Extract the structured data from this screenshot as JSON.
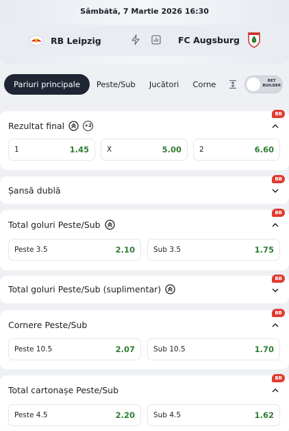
{
  "header": {
    "date": "Sâmbătă, 7 Martie 2026 16:30",
    "home_team": "RB Leipzig",
    "away_team": "FC Augsburg",
    "icons": [
      "rb-leipzig-crest",
      "lightning-icon",
      "stats-icon",
      "fc-augsburg-crest"
    ]
  },
  "tabs": [
    {
      "label": "Pariuri principale",
      "active": true
    },
    {
      "label": "Peste/Sub"
    },
    {
      "label": "Jucători"
    },
    {
      "label": "Corne"
    }
  ],
  "bet_builder": {
    "line1": "BET",
    "line2": "BUILDER"
  },
  "badge": "BB",
  "markets": [
    {
      "title": "Rezultat final",
      "extra": "+2",
      "outcomes": [
        {
          "label": "1",
          "odds": "1.45"
        },
        {
          "label": "X",
          "odds": "5.00"
        },
        {
          "label": "2",
          "odds": "6.60"
        }
      ]
    },
    {
      "title": "Șansă dublă",
      "outcomes": []
    },
    {
      "title": "Total goluri Peste/Sub",
      "outcomes": [
        {
          "label": "Peste 3.5",
          "odds": "2.10"
        },
        {
          "label": "Sub 3.5",
          "odds": "1.75"
        }
      ]
    },
    {
      "title": "Total goluri Peste/Sub (suplimentar)",
      "outcomes": []
    },
    {
      "title": "Cornere Peste/Sub",
      "outcomes": [
        {
          "label": "Peste 10.5",
          "odds": "2.07"
        },
        {
          "label": "Sub 10.5",
          "odds": "1.70"
        }
      ]
    },
    {
      "title": "Total cartonașe Peste/Sub",
      "outcomes": [
        {
          "label": "Peste 4.5",
          "odds": "2.20"
        },
        {
          "label": "Sub 4.5",
          "odds": "1.62"
        }
      ]
    }
  ],
  "colors": {
    "odds": "#2e7d32",
    "badge": "#e03a2f",
    "active_tab": "#1f2533"
  }
}
